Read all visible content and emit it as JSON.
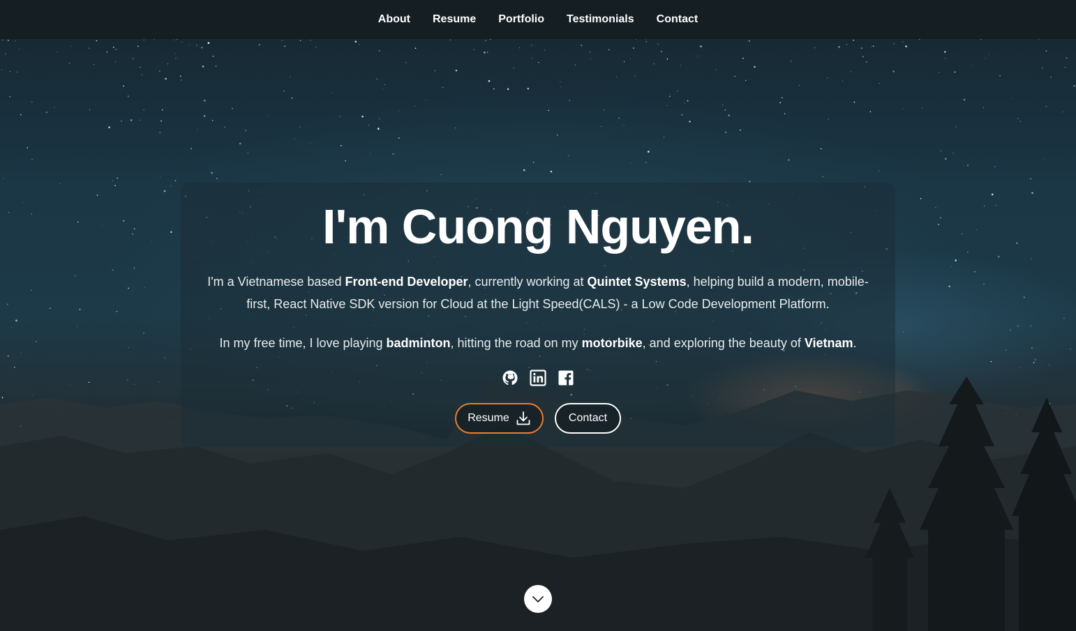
{
  "nav": {
    "items": [
      "About",
      "Resume",
      "Portfolio",
      "Testimonials",
      "Contact"
    ]
  },
  "hero": {
    "title": "I'm Cuong Nguyen.",
    "intro": {
      "t1": "I'm a Vietnamese based ",
      "b1": "Front-end Developer",
      "t2": ", currently working at ",
      "b2": "Quintet Systems",
      "t3": ", helping build a modern, mobile-first, React Native SDK version for Cloud at the Light Speed(CALS) - a Low Code Development Platform."
    },
    "hobby": {
      "t1": "In my free time, I love playing ",
      "b1": "badminton",
      "t2": ", hitting the road on my ",
      "b2": "motorbike",
      "t3": ", and exploring the beauty of ",
      "b3": "Vietnam",
      "t4": "."
    },
    "socials": [
      "github-icon",
      "linkedin-icon",
      "facebook-icon"
    ],
    "buttons": {
      "resume_label": "Resume",
      "contact_label": "Contact"
    }
  },
  "colors": {
    "accent": "#f07d2a",
    "nav_bg": "#161d21"
  }
}
